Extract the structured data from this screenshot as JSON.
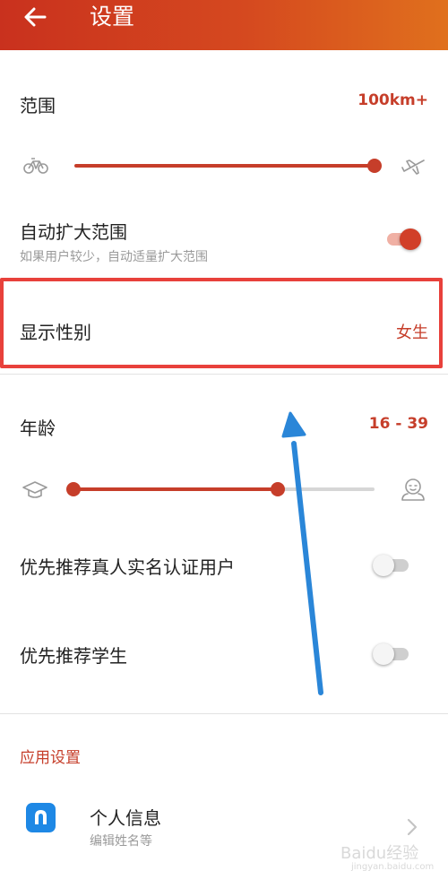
{
  "header": {
    "title": "设置",
    "back_icon": "arrow-left-icon",
    "gradient_colors": [
      "#c9311e",
      "#e0701d"
    ]
  },
  "range": {
    "label": "范围",
    "value": "100km+",
    "slider_value_fraction": 1.0,
    "min_icon": "bicycle-icon",
    "max_icon": "airplane-icon"
  },
  "auto_expand": {
    "label": "自动扩大范围",
    "description": "如果用户较少，自动适量扩大范围",
    "enabled": true
  },
  "show_gender": {
    "label": "显示性别",
    "value": "女生"
  },
  "age": {
    "label": "年龄",
    "value": "16 - 39",
    "range_min": 16,
    "range_max": 39,
    "min_icon": "graduation-cap-icon",
    "max_icon": "elderly-person-icon"
  },
  "prefer_verified": {
    "label": "优先推荐真人实名认证用户",
    "enabled": false
  },
  "prefer_students": {
    "label": "优先推荐学生",
    "enabled": false
  },
  "app_settings": {
    "section_title": "应用设置",
    "personal_info": {
      "label": "个人信息",
      "description": "编辑姓名等",
      "icon": "profile-icon"
    }
  },
  "watermark": {
    "text": "Baidu经验",
    "sub": "jingyan.baidu.com"
  },
  "colors": {
    "accent": "#c63e2a",
    "highlight": "#e8413b",
    "arrow": "#2a86d8",
    "app_icon": "#1e88e5"
  }
}
